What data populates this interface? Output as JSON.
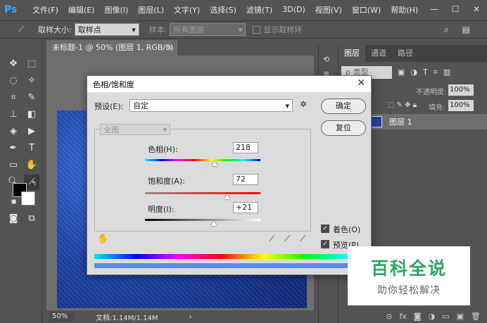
{
  "app": {
    "logo": "Ps",
    "menu": [
      "文件(F)",
      "编辑(E)",
      "图像(I)",
      "图层(L)",
      "文字(Y)",
      "选择(S)",
      "滤镜(T)",
      "3D(D)",
      "视图(V)",
      "窗口(W)",
      "帮助(H)"
    ],
    "window_controls": [
      "—",
      "☐",
      "✕"
    ]
  },
  "options_bar": {
    "sample_size_label": "取样大小:",
    "sample_size_value": "取样点",
    "sample_label": "样本:",
    "sample_value": "所有图层",
    "show_ring_label": "显示取样环"
  },
  "document": {
    "tab_title": "未标题-1 @ 50% (图层 1, RGB/8) *",
    "close": "×",
    "zoom": "50%",
    "doc_size": "文档:1.14M/1.14M",
    "status_arrow": "›"
  },
  "layers_panel": {
    "tabs": [
      "图层",
      "通道",
      "路径"
    ],
    "filter_kind": "p 类型",
    "opacity_label": "不透明度:",
    "opacity_value": "100%",
    "lock_label": "锁定:",
    "fill_label": "填充:",
    "fill_value": "100%",
    "layer_name": "图层 1"
  },
  "dialog": {
    "title": "色相/饱和度",
    "close": "✕",
    "preset_label": "预设(E):",
    "preset_value": "自定",
    "ok_label": "确定",
    "reset_label": "复位",
    "channel_value": "全图",
    "hue_label": "色相(H):",
    "hue_value": "218",
    "saturation_label": "饱和度(A):",
    "saturation_value": "72",
    "lightness_label": "明度(I):",
    "lightness_value": "+21",
    "colorize_label": "着色(O)",
    "preview_label": "预览(P)",
    "colorize_checked": true,
    "preview_checked": true
  },
  "watermark": {
    "title": "百科全说",
    "subtitle": "助你轻松解决"
  },
  "colors": {
    "accent": "#31a8ff",
    "watermark_green": "#2aa760"
  }
}
